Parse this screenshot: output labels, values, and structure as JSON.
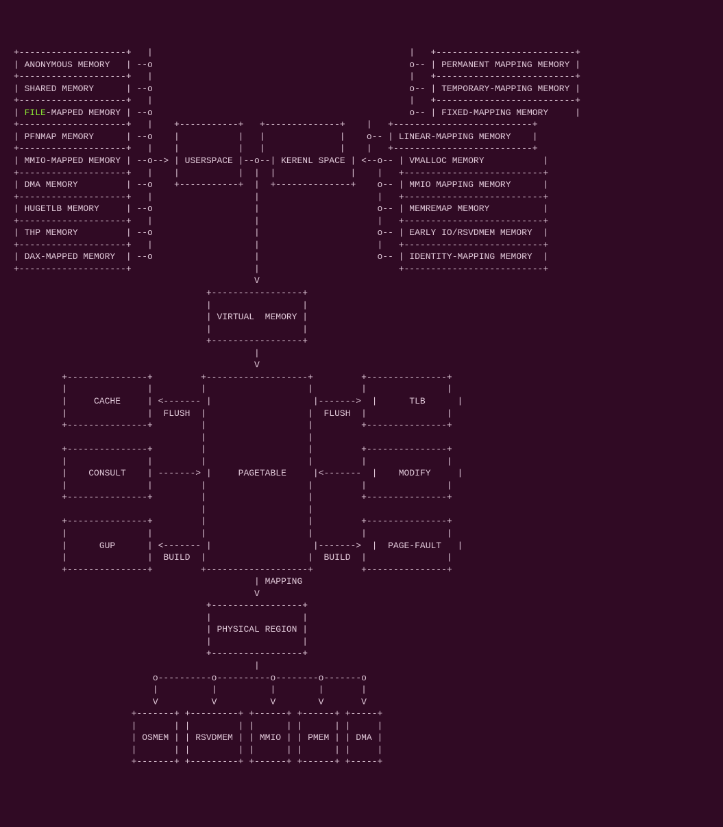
{
  "userspace_items": [
    "ANONYMOUS MEMORY",
    "SHARED MEMORY",
    "FILE-MAPPED MEMORY",
    "PFNMAP MEMORY",
    "MMIO-MAPPED MEMORY",
    "DMA MEMORY",
    "HUGETLB MEMORY",
    "THP MEMORY",
    "DAX-MAPPED MEMORY"
  ],
  "kernelspace_items": [
    "PERMANENT MAPPING MEMORY",
    "TEMPORARY-MAPPING MEMORY",
    "FIXED-MAPPING MEMORY",
    "LINEAR-MAPPING MEMORY",
    "VMALLOC MEMORY",
    "MMIO MAPPING MEMORY",
    "MEMREMAP MEMORY",
    "EARLY IO/RSVDMEM MEMORY",
    "IDENTITY-MAPPING MEMORY"
  ],
  "center_top_left": "USERSPACE",
  "center_top_right": "KERENL SPACE",
  "virtual_memory": "VIRTUAL  MEMORY",
  "row1": {
    "left": "CACHE",
    "left_conn": "FLUSH",
    "right_conn": "FLUSH",
    "right": "TLB"
  },
  "row2": {
    "left": "CONSULT",
    "center": "PAGETABLE",
    "right": "MODIFY"
  },
  "row3": {
    "left": "GUP",
    "left_conn": "BUILD",
    "right_conn": "BUILD",
    "right": "PAGE-FAULT"
  },
  "mapping_label": "MAPPING",
  "physical_region": "PHYSICAL REGION",
  "bottom": [
    "OSMEM",
    "RSVDMEM",
    "MMIO",
    "PMEM",
    "DMA"
  ],
  "highlight_word": "FILE"
}
